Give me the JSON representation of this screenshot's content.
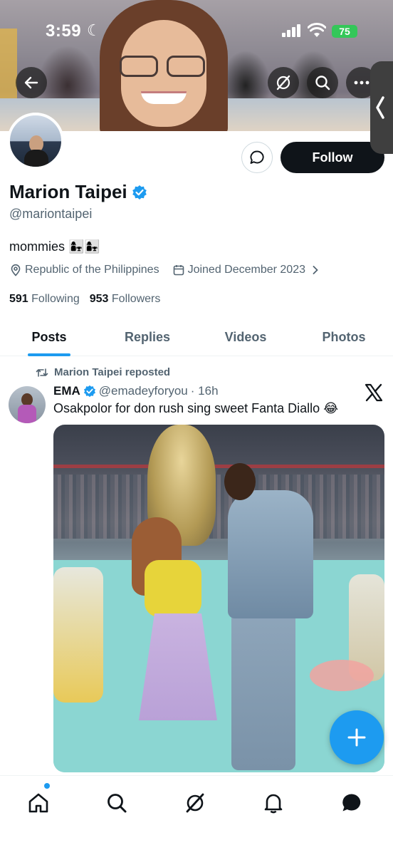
{
  "status_bar": {
    "time": "3:59",
    "battery": "75"
  },
  "header": {
    "back_icon": "arrow-left-icon",
    "grok_icon": "grok-icon",
    "search_icon": "search-icon",
    "more_icon": "more-horizontal-icon"
  },
  "profile": {
    "display_name": "Marion Taipei",
    "handle": "@mariontaipei",
    "bio": "mommies 👩‍👧👩‍👧",
    "location": "Republic of the Philippines",
    "joined": "Joined December 2023",
    "following_count": "591",
    "following_label": "Following",
    "followers_count": "953",
    "followers_label": "Followers",
    "follow_label": "Follow"
  },
  "tabs": [
    {
      "label": "Posts",
      "active": true
    },
    {
      "label": "Replies",
      "active": false
    },
    {
      "label": "Videos",
      "active": false
    },
    {
      "label": "Photos",
      "active": false
    }
  ],
  "post": {
    "repost_label": "Marion Taipei reposted",
    "author_name": "EMA",
    "author_handle": "@emadeyforyou",
    "time": "· 16h",
    "text": "Osakpolor for don rush sing sweet Fanta Diallo 😂"
  },
  "colors": {
    "accent": "#1d9bf0",
    "text_primary": "#0f1419",
    "text_secondary": "#536471",
    "battery": "#34c759"
  }
}
